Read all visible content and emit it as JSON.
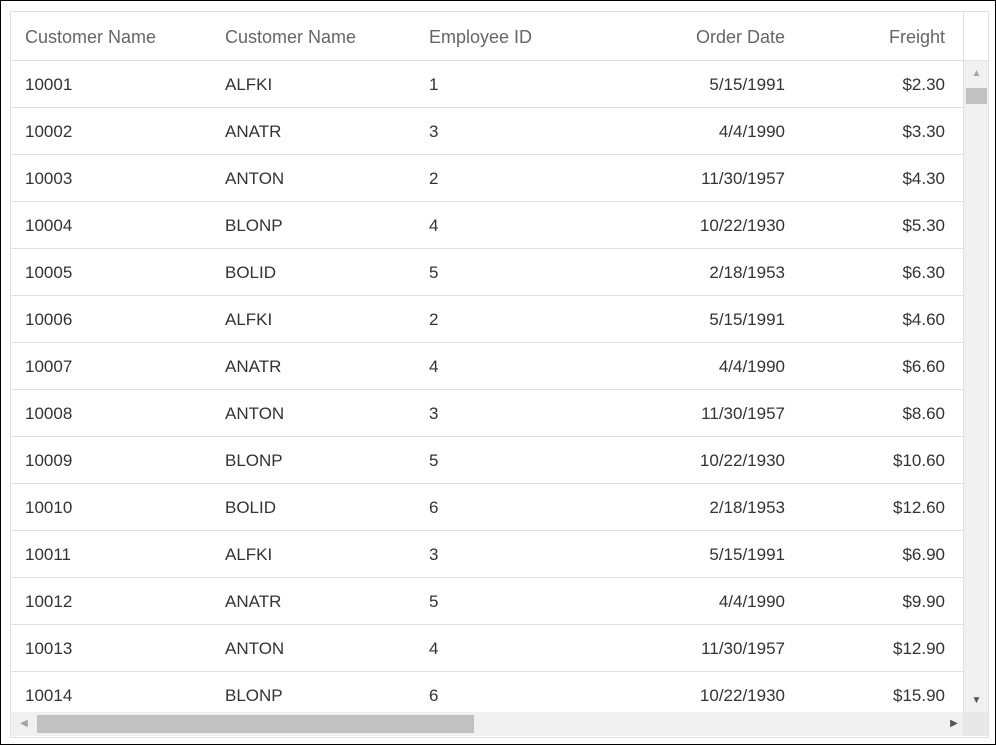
{
  "grid": {
    "columns": [
      {
        "label": "Customer Name"
      },
      {
        "label": "Customer Name"
      },
      {
        "label": "Employee ID"
      },
      {
        "label": "Order Date"
      },
      {
        "label": "Freight"
      }
    ],
    "rows": [
      [
        "10001",
        "ALFKI",
        "1",
        "5/15/1991",
        "$2.30"
      ],
      [
        "10002",
        "ANATR",
        "3",
        "4/4/1990",
        "$3.30"
      ],
      [
        "10003",
        "ANTON",
        "2",
        "11/30/1957",
        "$4.30"
      ],
      [
        "10004",
        "BLONP",
        "4",
        "10/22/1930",
        "$5.30"
      ],
      [
        "10005",
        "BOLID",
        "5",
        "2/18/1953",
        "$6.30"
      ],
      [
        "10006",
        "ALFKI",
        "2",
        "5/15/1991",
        "$4.60"
      ],
      [
        "10007",
        "ANATR",
        "4",
        "4/4/1990",
        "$6.60"
      ],
      [
        "10008",
        "ANTON",
        "3",
        "11/30/1957",
        "$8.60"
      ],
      [
        "10009",
        "BLONP",
        "5",
        "10/22/1930",
        "$10.60"
      ],
      [
        "10010",
        "BOLID",
        "6",
        "2/18/1953",
        "$12.60"
      ],
      [
        "10011",
        "ALFKI",
        "3",
        "5/15/1991",
        "$6.90"
      ],
      [
        "10012",
        "ANATR",
        "5",
        "4/4/1990",
        "$9.90"
      ],
      [
        "10013",
        "ANTON",
        "4",
        "11/30/1957",
        "$12.90"
      ],
      [
        "10014",
        "BLONP",
        "6",
        "10/22/1930",
        "$15.90"
      ]
    ]
  },
  "scrollbars": {
    "vertical": {
      "up_icon": "scroll-up-arrow-icon",
      "down_icon": "scroll-down-arrow-icon",
      "up_glyph": "▲",
      "down_glyph": "▼"
    },
    "horizontal": {
      "left_icon": "scroll-left-arrow-icon",
      "right_icon": "scroll-right-arrow-icon",
      "left_glyph": "◀",
      "right_glyph": "▶"
    }
  }
}
